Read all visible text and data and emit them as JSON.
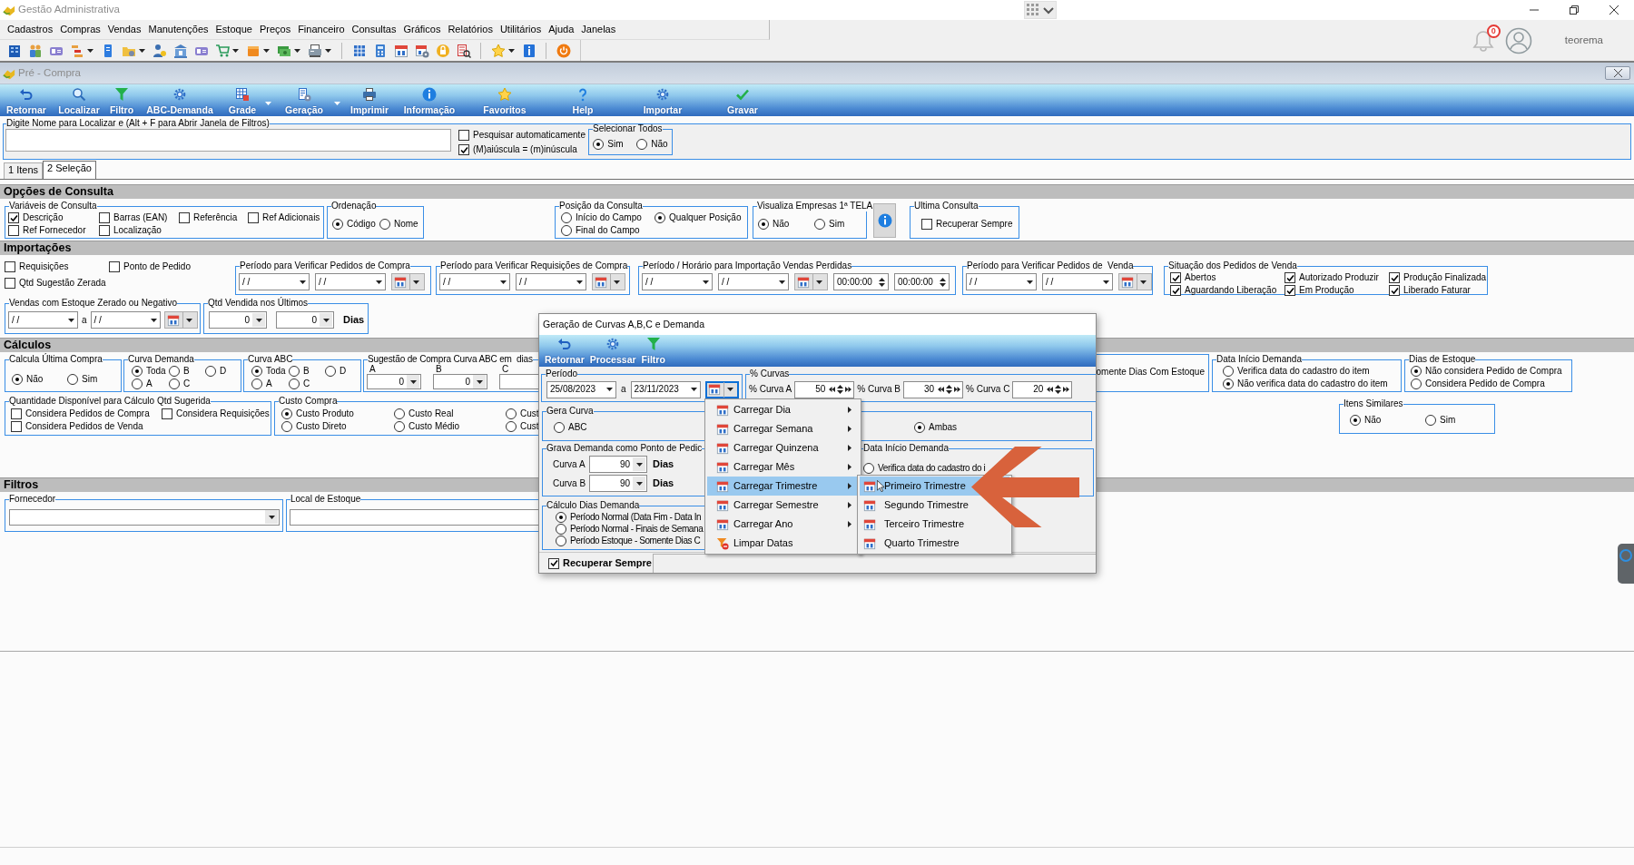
{
  "app": {
    "title": "Gestão Administrativa",
    "menu": [
      "Cadastros",
      "Compras",
      "Vendas",
      "Manutenções",
      "Estoque",
      "Preços",
      "Financeiro",
      "Consultas",
      "Gráficos",
      "Relatórios",
      "Utilitários",
      "Ajuda",
      "Janelas"
    ],
    "notifications": "0",
    "user": "teorema"
  },
  "window": {
    "title": "Pré - Compra",
    "toolbar": [
      {
        "label": "Retornar",
        "has_menu": false
      },
      {
        "label": "Localizar",
        "has_menu": false
      },
      {
        "label": "Filtro",
        "has_menu": false
      },
      {
        "label": "ABC-Demanda",
        "has_menu": false
      },
      {
        "label": "Grade",
        "has_menu": true
      },
      {
        "label": "Geração",
        "has_menu": true
      },
      {
        "label": "Imprimir",
        "has_menu": false
      },
      {
        "label": "Informação",
        "has_menu": false
      },
      {
        "label": "Favoritos",
        "has_menu": false
      },
      {
        "label": "Help",
        "has_menu": false
      },
      {
        "label": "Importar",
        "has_menu": false
      },
      {
        "label": "Gravar",
        "has_menu": false
      }
    ]
  },
  "search": {
    "title": "Digite Nome para Localizar e (Alt + F para Abrir Janela de Filtros)",
    "options": [
      {
        "label": "Pesquisar automaticamente",
        "checked": false
      },
      {
        "label": "(M)aiúscula = (m)inúscula",
        "checked": true
      }
    ],
    "select_all": {
      "title": "Selecionar Todos",
      "options": [
        {
          "label": "Sim",
          "selected": true
        },
        {
          "label": "Não",
          "selected": false
        }
      ]
    }
  },
  "tabs": [
    {
      "label": "1 Itens",
      "selected": false
    },
    {
      "label": "2 Seleção",
      "selected": true
    }
  ],
  "sections": [
    {
      "title": "Opções de Consulta",
      "rows": [
        {
          "groups": [
            {
              "kind": "group",
              "title": "Variáveis de Consulta",
              "rows": [
                [
                  {
                    "kind": "check",
                    "label": "Descrição",
                    "checked": true
                  },
                  {
                    "kind": "check",
                    "label": "Barras (EAN)",
                    "checked": false
                  },
                  {
                    "kind": "check",
                    "label": "Referência",
                    "checked": false
                  },
                  {
                    "kind": "check",
                    "label": "Ref Adicionais",
                    "checked": false
                  }
                ],
                [
                  {
                    "kind": "check",
                    "label": "Ref Fornecedor",
                    "checked": false
                  },
                  {
                    "kind": "check",
                    "label": "Localização",
                    "checked": false
                  }
                ]
              ]
            },
            {
              "kind": "group",
              "title": "Ordenação",
              "rows": [
                [
                  {
                    "kind": "radio",
                    "label": "Código",
                    "selected": true
                  },
                  {
                    "kind": "radio",
                    "label": "Nome",
                    "selected": false
                  }
                ]
              ]
            },
            {
              "kind": "group",
              "title": "Posição da Consulta",
              "rows": [
                [
                  {
                    "kind": "radio",
                    "label": "Início do Campo",
                    "selected": false
                  },
                  {
                    "kind": "radio",
                    "label": "Qualquer Posição",
                    "selected": true
                  }
                ],
                [
                  {
                    "kind": "radio",
                    "label": "Final do Campo",
                    "selected": false
                  }
                ]
              ]
            },
            {
              "kind": "group",
              "title": "Visualiza Empresas 1ª TELA",
              "rows": [
                [
                  {
                    "kind": "radio",
                    "label": "Não",
                    "selected": true
                  },
                  {
                    "kind": "radio",
                    "label": "Sim",
                    "selected": false
                  }
                ]
              ]
            },
            {
              "kind": "info_button"
            },
            {
              "kind": "group",
              "title": "Ultima Consulta",
              "rows": [
                [
                  {
                    "kind": "check",
                    "label": "Recuperar Sempre",
                    "checked": false
                  }
                ]
              ]
            }
          ]
        }
      ]
    },
    {
      "title": "Importações",
      "rows": [
        {
          "groups": [
            {
              "kind": "plain",
              "rows": [
                [
                  {
                    "kind": "check",
                    "label": "Requisições",
                    "checked": false
                  },
                  {
                    "kind": "check",
                    "label": "Ponto de Pedido",
                    "checked": false
                  }
                ],
                [
                  {
                    "kind": "check",
                    "label": "Qtd Sugestão Zerada",
                    "checked": false
                  }
                ]
              ]
            },
            {
              "kind": "group",
              "title": "Período para Verificar Pedidos de Compra",
              "rows": [
                [
                  {
                    "kind": "date",
                    "value": "/ /"
                  },
                  {
                    "kind": "date",
                    "value": "/ /"
                  },
                  {
                    "kind": "calendar"
                  }
                ]
              ]
            },
            {
              "kind": "group",
              "title": "Período para Verificar Requisições de Compra",
              "rows": [
                [
                  {
                    "kind": "date",
                    "value": "/ /"
                  },
                  {
                    "kind": "date",
                    "value": "/ /"
                  },
                  {
                    "kind": "calendar"
                  }
                ]
              ]
            },
            {
              "kind": "group",
              "title": "Período / Horário para Importação Vendas Perdidas",
              "rows": [
                [
                  {
                    "kind": "date",
                    "value": "/ /"
                  },
                  {
                    "kind": "date",
                    "value": "/ /"
                  },
                  {
                    "kind": "calendar"
                  },
                  {
                    "kind": "time",
                    "value": "00:00:00"
                  },
                  {
                    "kind": "time",
                    "value": "00:00:00"
                  }
                ]
              ]
            },
            {
              "kind": "group",
              "title": "Período para Verificar Pedidos de  Venda",
              "rows": [
                [
                  {
                    "kind": "date",
                    "value": "/ /"
                  },
                  {
                    "kind": "date",
                    "value": "/ /"
                  },
                  {
                    "kind": "calendar"
                  }
                ]
              ]
            },
            {
              "kind": "group",
              "title": "Situação dos Pedidos de Venda",
              "rows": [
                [
                  {
                    "kind": "check",
                    "label": "Abertos",
                    "checked": true
                  },
                  {
                    "kind": "check",
                    "label": "Autorizado Produzir",
                    "checked": true
                  },
                  {
                    "kind": "check",
                    "label": "Produção Finalizada",
                    "checked": true
                  }
                ],
                [
                  {
                    "kind": "check",
                    "label": "Aguardando Liberação",
                    "checked": true
                  },
                  {
                    "kind": "check",
                    "label": "Em Produção",
                    "checked": true
                  },
                  {
                    "kind": "check",
                    "label": "Liberado Faturar",
                    "checked": true
                  }
                ]
              ]
            }
          ]
        },
        {
          "groups": [
            {
              "kind": "group",
              "title": "Vendas com Estoque Zerado ou Negativo",
              "rows": [
                [
                  {
                    "kind": "date",
                    "value": "/ /"
                  },
                  {
                    "kind": "text",
                    "text": "a"
                  },
                  {
                    "kind": "date",
                    "value": "/ /"
                  },
                  {
                    "kind": "calendar"
                  }
                ]
              ]
            },
            {
              "kind": "group",
              "title": "Qtd Vendida nos Últimos",
              "rows": [
                [
                  {
                    "kind": "combo",
                    "value": "0"
                  },
                  {
                    "kind": "combo",
                    "value": "0"
                  },
                  {
                    "kind": "unit",
                    "text": "Dias"
                  }
                ]
              ]
            }
          ]
        }
      ]
    },
    {
      "title": "Cálculos",
      "rows": [
        {
          "groups": [
            {
              "kind": "group",
              "title": "Calcula Última Compra",
              "rows": [
                [
                  {
                    "kind": "radio",
                    "label": "Não",
                    "selected": true
                  },
                  {
                    "kind": "radio",
                    "label": "Sim",
                    "selected": false
                  }
                ]
              ]
            },
            {
              "kind": "group",
              "title": "Curva Demanda",
              "rows": [
                [
                  {
                    "kind": "radio",
                    "label": "Toda",
                    "selected": true
                  },
                  {
                    "kind": "radio",
                    "label": "B",
                    "selected": false
                  },
                  {
                    "kind": "radio",
                    "label": "D",
                    "selected": false
                  }
                ],
                [
                  {
                    "kind": "radio",
                    "label": "A",
                    "selected": false
                  },
                  {
                    "kind": "radio",
                    "label": "C",
                    "selected": false
                  }
                ]
              ]
            },
            {
              "kind": "group",
              "title": "Curva ABC",
              "rows": [
                [
                  {
                    "kind": "radio",
                    "label": "Toda",
                    "selected": true
                  },
                  {
                    "kind": "radio",
                    "label": "B",
                    "selected": false
                  },
                  {
                    "kind": "radio",
                    "label": "D",
                    "selected": false
                  }
                ],
                [
                  {
                    "kind": "radio",
                    "label": "A",
                    "selected": false
                  },
                  {
                    "kind": "radio",
                    "label": "C",
                    "selected": false
                  }
                ]
              ]
            },
            {
              "kind": "group",
              "title": "Sugestão de Compra Curva ABC em  dias",
              "rows": [
                [
                  {
                    "kind": "text",
                    "text": "A"
                  },
                  {
                    "kind": "text",
                    "text": "B"
                  },
                  {
                    "kind": "text",
                    "text": "C"
                  }
                ],
                [
                  {
                    "kind": "combo",
                    "value": "0"
                  },
                  {
                    "kind": "combo",
                    "value": "0"
                  },
                  {
                    "kind": "combo"
                  }
                ]
              ]
            },
            {
              "kind": "group",
              "rows": [
                [
                  {
                    "kind": "text",
                    "text": "omente Dias Com Estoque"
                  }
                ]
              ]
            },
            {
              "kind": "group",
              "title": "Data Início Demanda",
              "rows": [
                [
                  {
                    "kind": "radio",
                    "label": "Verifica data do cadastro do item",
                    "selected": false
                  }
                ],
                [
                  {
                    "kind": "radio",
                    "label": "Não verifica data do cadastro do item",
                    "selected": true
                  }
                ]
              ]
            },
            {
              "kind": "group",
              "title": "Dias de Estoque",
              "rows": [
                [
                  {
                    "kind": "radio",
                    "label": "Não considera Pedido de Compra",
                    "selected": true
                  }
                ],
                [
                  {
                    "kind": "radio",
                    "label": "Considera Pedido de Compra",
                    "selected": false
                  }
                ]
              ]
            }
          ]
        },
        {
          "groups": [
            {
              "kind": "group",
              "title": "Quantidade Disponível para Cálculo Qtd Sugerida",
              "rows": [
                [
                  {
                    "kind": "check",
                    "label": "Considera Pedidos de Compra",
                    "checked": false
                  },
                  {
                    "kind": "check",
                    "label": "Considera Requisições",
                    "checked": false
                  }
                ],
                [
                  {
                    "kind": "check",
                    "label": "Considera Pedidos de Venda",
                    "checked": false
                  }
                ]
              ]
            },
            {
              "kind": "group",
              "title": "Custo Compra",
              "rows": [
                [
                  {
                    "kind": "radio",
                    "label": "Custo Produto",
                    "selected": true
                  },
                  {
                    "kind": "radio",
                    "label": "Custo Real",
                    "selected": false
                  },
                  {
                    "kind": "radio",
                    "label": "Cust",
                    "selected": false
                  }
                ],
                [
                  {
                    "kind": "radio",
                    "label": "Custo Direto",
                    "selected": false
                  },
                  {
                    "kind": "radio",
                    "label": "Custo Médio",
                    "selected": false
                  },
                  {
                    "kind": "radio",
                    "label": "Cust",
                    "selected": false
                  }
                ]
              ]
            },
            {
              "kind": "group",
              "title": "Itens Similares",
              "rows": [
                [
                  {
                    "kind": "radio",
                    "label": "Não",
                    "selected": true
                  },
                  {
                    "kind": "radio",
                    "label": "Sim",
                    "selected": false
                  }
                ]
              ]
            }
          ]
        }
      ]
    },
    {
      "title": "Filtros",
      "rows": [
        {
          "groups": [
            {
              "kind": "group",
              "title": "Fornecedor",
              "rows": [
                [
                  {
                    "kind": "combo"
                  }
                ]
              ]
            },
            {
              "kind": "group",
              "title": "Local de Estoque",
              "rows": [
                [
                  {
                    "kind": "input"
                  }
                ]
              ]
            }
          ]
        }
      ]
    }
  ],
  "dialog": {
    "title": "Geração de Curvas A,B,C e Demanda",
    "toolbar": [
      "Retornar",
      "Processar",
      "Filtro"
    ],
    "rows": [
      {
        "groups": [
          {
            "kind": "group",
            "title": "Período",
            "rows": [
              [
                {
                  "kind": "date",
                  "value": "25/08/2023"
                },
                {
                  "kind": "text",
                  "text": "a"
                },
                {
                  "kind": "date",
                  "value": "23/11/2023"
                },
                {
                  "kind": "calendar",
                  "focused": true
                }
              ]
            ]
          },
          {
            "kind": "group",
            "title": "% Curvas",
            "rows": [
              [
                {
                  "kind": "text",
                  "text": "% Curva A"
                },
                {
                  "kind": "percent",
                  "value": "50"
                },
                {
                  "kind": "text",
                  "text": "% Curva B"
                },
                {
                  "kind": "percent",
                  "value": "30"
                },
                {
                  "kind": "text",
                  "text": "% Curva C"
                },
                {
                  "kind": "percent",
                  "value": "20"
                }
              ]
            ]
          }
        ]
      },
      {
        "groups": [
          {
            "kind": "group",
            "title": "Gera Curva",
            "rows": [
              [
                {
                  "kind": "radio",
                  "label": "ABC",
                  "selected": false
                },
                {
                  "kind": "radio",
                  "label": "Ambas",
                  "selected": true
                }
              ]
            ]
          }
        ]
      },
      {
        "groups": [
          {
            "kind": "group",
            "title": "Grava Demanda como Ponto de Pedic",
            "rows": [
              [
                {
                  "kind": "text",
                  "text": "Curva A"
                },
                {
                  "kind": "combo",
                  "value": "90"
                },
                {
                  "kind": "unit",
                  "text": "Dias"
                }
              ],
              [
                {
                  "kind": "text",
                  "text": "Curva B"
                },
                {
                  "kind": "combo",
                  "value": "90"
                },
                {
                  "kind": "unit",
                  "text": "Dias"
                }
              ]
            ]
          },
          {
            "kind": "group",
            "title": "Data Início Demanda",
            "rows": [
              [
                {
                  "kind": "radio",
                  "label": "Verifica data do cadastro do i",
                  "selected": false
                }
              ]
            ]
          }
        ]
      },
      {
        "groups": [
          {
            "kind": "group",
            "title": "Cálculo Dias Demanda",
            "rows": [
              [
                {
                  "kind": "radio",
                  "label": "Período Normal (Data Fim - Data In",
                  "selected": true
                }
              ],
              [
                {
                  "kind": "radio",
                  "label": "Período Normal - Finais de Semana",
                  "selected": false
                }
              ],
              [
                {
                  "kind": "radio",
                  "label": "Período Estoque - Somente Dias C",
                  "selected": false
                }
              ]
            ]
          }
        ]
      }
    ],
    "recover": {
      "label": "Recuperar Sempre",
      "checked": true
    }
  },
  "context_menu": {
    "items": [
      {
        "label": "Carregar Dia",
        "kind": "load",
        "has_submenu": true,
        "selected": false
      },
      {
        "label": "Carregar Semana",
        "kind": "load",
        "has_submenu": true,
        "selected": false
      },
      {
        "label": "Carregar Quinzena",
        "kind": "load",
        "has_submenu": true,
        "selected": false
      },
      {
        "label": "Carregar Mês",
        "kind": "load",
        "has_submenu": true,
        "selected": false
      },
      {
        "label": "Carregar Trimestre",
        "kind": "load",
        "has_submenu": true,
        "selected": true
      },
      {
        "label": "Carregar Semestre",
        "kind": "load",
        "has_submenu": true,
        "selected": false
      },
      {
        "label": "Carregar Ano",
        "kind": "load",
        "has_submenu": true,
        "selected": false
      },
      {
        "label": "Limpar Datas",
        "kind": "clear",
        "has_submenu": false,
        "selected": false
      }
    ],
    "submenu": [
      {
        "label": "Primeiro Trimestre",
        "selected": true
      },
      {
        "label": "Segundo Trimestre",
        "selected": false
      },
      {
        "label": "Terceiro Trimestre",
        "selected": false
      },
      {
        "label": "Quarto Trimestre",
        "selected": false
      }
    ]
  }
}
